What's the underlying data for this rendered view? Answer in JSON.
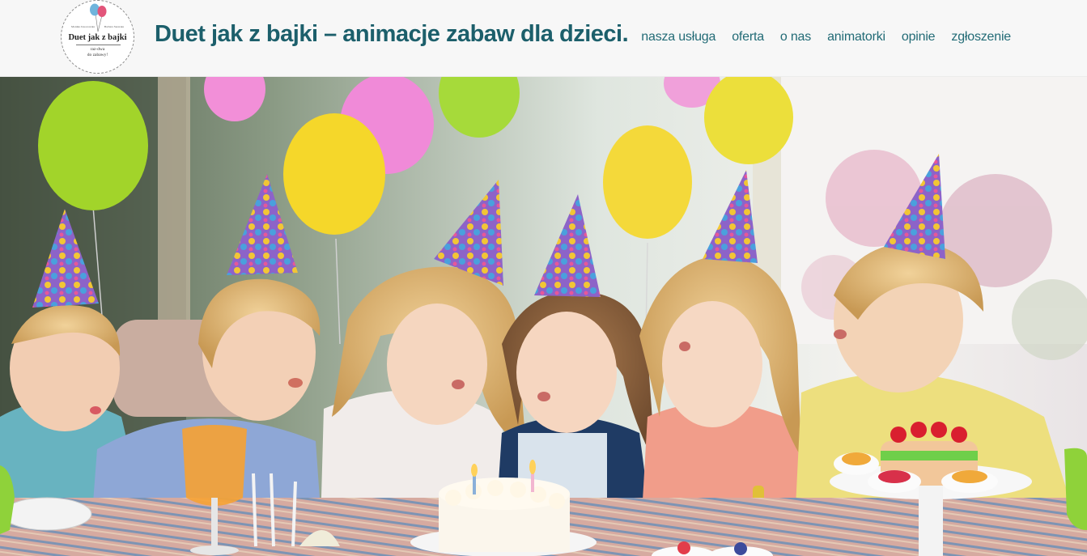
{
  "site": {
    "logo_text": {
      "top_left": "Monika Jaworowska",
      "top_right": "Barbara Szewska",
      "name": "Duet jak z bajki",
      "tagline_1": "raz-dwa",
      "tagline_2": "do zabawy!"
    },
    "title": "Duet jak z bajki – animacje zabaw dla dzieci."
  },
  "nav": {
    "items": [
      {
        "label": "nasza usługa"
      },
      {
        "label": "oferta"
      },
      {
        "label": "o nas"
      },
      {
        "label": "animatorki"
      },
      {
        "label": "opinie"
      },
      {
        "label": "zgłoszenie"
      }
    ]
  },
  "hero": {
    "image_description": "children in party hats blowing out birthday cake candles",
    "colors": {
      "accent": "#1c5f6b",
      "nav_link": "#226b76",
      "header_bg": "#f7f7f7"
    }
  }
}
